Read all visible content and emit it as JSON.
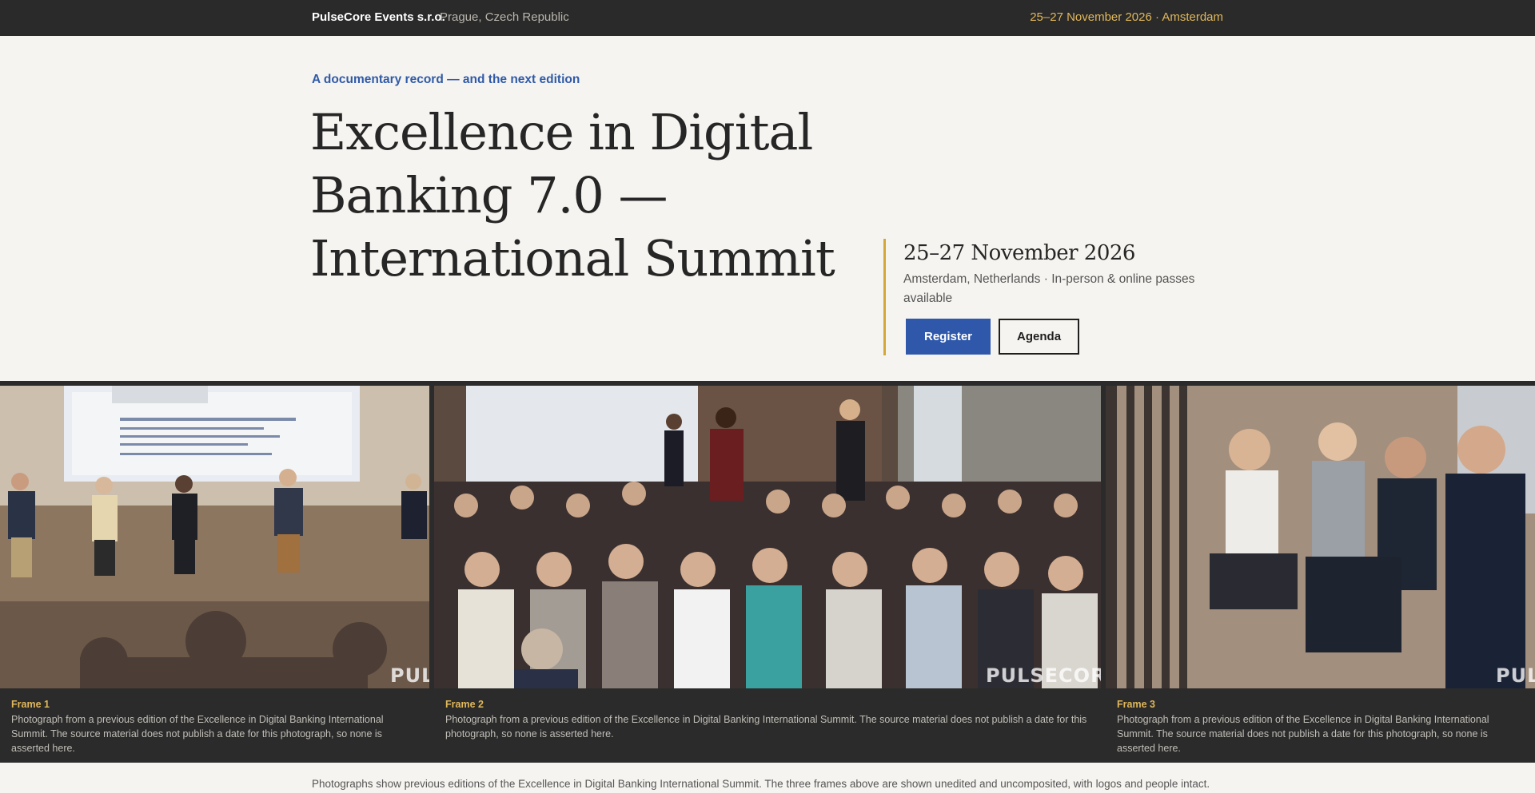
{
  "topbar": {
    "org": "PulseCore Events s.r.o.",
    "location": "Prague, Czech Republic",
    "event_date": "25–27 November 2026 · Amsterdam"
  },
  "hero": {
    "eyebrow": "A documentary record — and the next edition",
    "title": "Excellence in Digital Banking 7.0 — International Summit"
  },
  "info": {
    "date": "25–27 November 2026",
    "details": "Amsterdam, Netherlands · In-person & online passes available",
    "register_label": "Register",
    "agenda_label": "Agenda"
  },
  "gallery": {
    "watermark": "PULSECORE",
    "frames": [
      {
        "label": "Frame 1",
        "caption": "Photograph from a previous edition of the Excellence in Digital Banking International Summit. The source material does not publish a date for this photograph, so none is asserted here."
      },
      {
        "label": "Frame 2",
        "caption": "Photograph from a previous edition of the Excellence in Digital Banking International Summit. The source material does not publish a date for this photograph, so none is asserted here."
      },
      {
        "label": "Frame 3",
        "caption": "Photograph from a previous edition of the Excellence in Digital Banking International Summit. The source material does not publish a date for this photograph, so none is asserted here."
      }
    ]
  },
  "footer": {
    "note": "Photographs show previous editions of the Excellence in Digital Banking International Summit. The three frames above are shown unedited and uncomposited, with logos and people intact."
  },
  "colors": {
    "accent_blue": "#2f58ab",
    "accent_gold": "#d4a838",
    "dark": "#2a2a2a",
    "background": "#f6f4f0"
  }
}
